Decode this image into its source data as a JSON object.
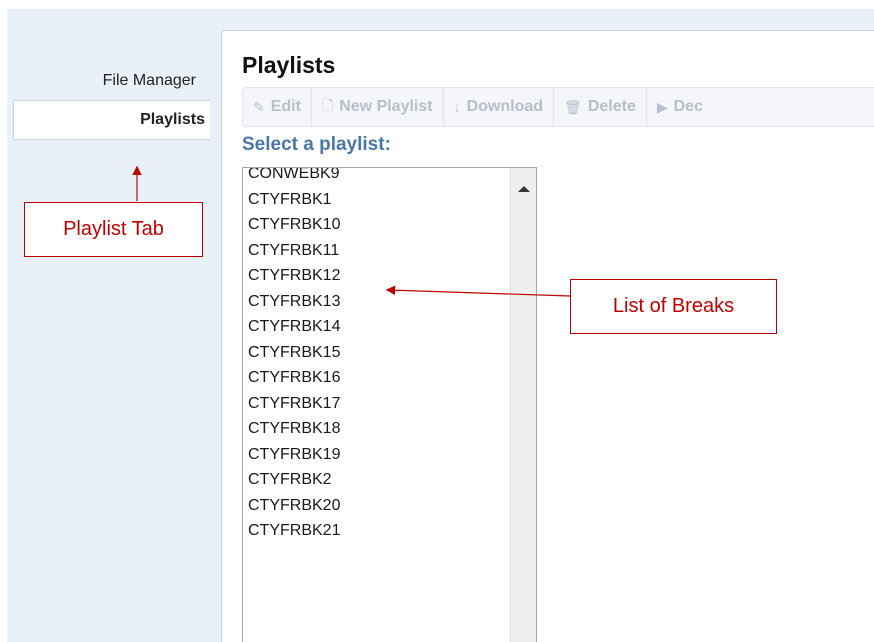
{
  "sidebar": {
    "tabs": [
      {
        "label": "File Manager",
        "active": false
      },
      {
        "label": "Playlists",
        "active": true
      }
    ]
  },
  "main": {
    "title": "Playlists",
    "toolbar": [
      {
        "icon": "pencil-icon",
        "glyph": "✎",
        "label": "Edit"
      },
      {
        "icon": "new-document-icon",
        "glyph": "🗋",
        "label": "New Playlist"
      },
      {
        "icon": "download-arrow-icon",
        "glyph": "↓",
        "label": "Download"
      },
      {
        "icon": "trash-icon",
        "glyph": "🗑",
        "label": "Delete"
      },
      {
        "icon": "play-icon",
        "glyph": "▶",
        "label": "Dec"
      }
    ],
    "select_label": "Select a playlist:",
    "playlists": [
      "CONWEBK9",
      "CTYFRBK1",
      "CTYFRBK10",
      "CTYFRBK11",
      "CTYFRBK12",
      "CTYFRBK13",
      "CTYFRBK14",
      "CTYFRBK15",
      "CTYFRBK16",
      "CTYFRBK17",
      "CTYFRBK18",
      "CTYFRBK19",
      "CTYFRBK2",
      "CTYFRBK20",
      "CTYFRBK21"
    ]
  },
  "annotations": {
    "playlist_tab": "Playlist Tab",
    "list_of_breaks": "List of Breaks",
    "color": "#c00000"
  },
  "colors": {
    "background": "#eaf0f8",
    "label_accent": "#4a76a8",
    "toolbar_disabled_text": "#b6bfca"
  }
}
